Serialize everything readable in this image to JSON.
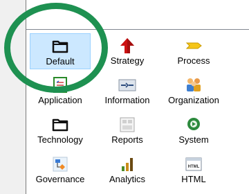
{
  "gallery": {
    "items": [
      {
        "label": "Default",
        "icon": "folder-icon"
      },
      {
        "label": "Strategy",
        "icon": "strategy-icon"
      },
      {
        "label": "Process",
        "icon": "process-icon"
      },
      {
        "label": "Application",
        "icon": "application-icon"
      },
      {
        "label": "Information",
        "icon": "information-icon"
      },
      {
        "label": "Organization",
        "icon": "organization-icon"
      },
      {
        "label": "Technology",
        "icon": "technology-folder-icon"
      },
      {
        "label": "Reports",
        "icon": "reports-icon"
      },
      {
        "label": "System",
        "icon": "system-icon"
      },
      {
        "label": "Governance",
        "icon": "governance-icon"
      },
      {
        "label": "Analytics",
        "icon": "analytics-icon"
      },
      {
        "label": "HTML",
        "icon": "html-icon"
      }
    ],
    "selected_index": 0,
    "html_badge": "HTML"
  },
  "colors": {
    "selection_fill": "#cce8ff",
    "highlight_ring": "#1e9151"
  }
}
